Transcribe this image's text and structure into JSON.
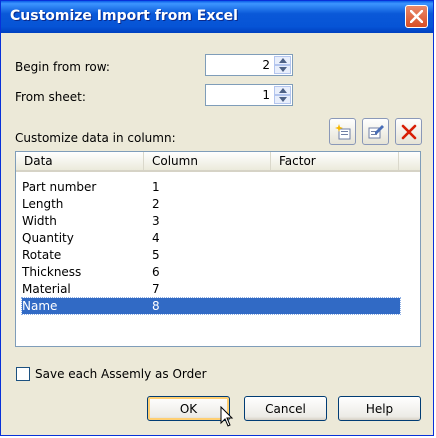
{
  "window": {
    "title": "Customize Import from Excel"
  },
  "fields": {
    "begin_row": {
      "label": "Begin from row:",
      "value": "2"
    },
    "from_sheet": {
      "label": "From sheet:",
      "value": "1"
    }
  },
  "customize_label": "Customize data in column:",
  "toolbar": {
    "icons": [
      "add-icon",
      "edit-icon",
      "delete-icon"
    ]
  },
  "table": {
    "columns": [
      "Data",
      "Column",
      "Factor"
    ],
    "rows": [
      {
        "data": "Part number",
        "column": "1",
        "factor": ""
      },
      {
        "data": "Length",
        "column": "2",
        "factor": ""
      },
      {
        "data": "Width",
        "column": "3",
        "factor": ""
      },
      {
        "data": "Quantity",
        "column": "4",
        "factor": ""
      },
      {
        "data": "Rotate",
        "column": "5",
        "factor": ""
      },
      {
        "data": "Thickness",
        "column": "6",
        "factor": ""
      },
      {
        "data": "Material",
        "column": "7",
        "factor": ""
      },
      {
        "data": "Name",
        "column": "8",
        "factor": ""
      }
    ],
    "selected_row": "Name"
  },
  "checkbox": {
    "label": "Save each Assemly as Order",
    "checked": false
  },
  "buttons": {
    "ok": "OK",
    "cancel": "Cancel",
    "help": "Help"
  },
  "colors": {
    "title_bar": "#0a58d8",
    "selection": "#316ac5",
    "dialog_bg": "#ece9d8",
    "close": "#d84e25"
  }
}
